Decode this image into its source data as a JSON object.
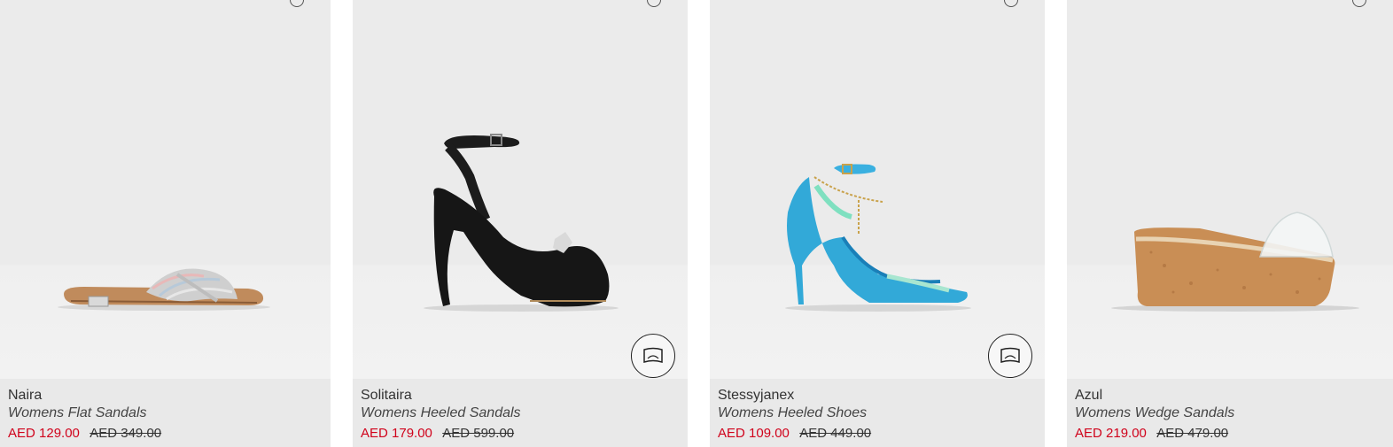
{
  "products": [
    {
      "name": "Naira",
      "category": "Womens Flat Sandals",
      "sale_price": "AED 129.00",
      "original_price": "AED 349.00",
      "has_3d_view": false
    },
    {
      "name": "Solitaira",
      "category": "Womens Heeled Sandals",
      "sale_price": "AED 179.00",
      "original_price": "AED 599.00",
      "has_3d_view": true
    },
    {
      "name": "Stessyjanex",
      "category": "Womens Heeled Shoes",
      "sale_price": "AED 109.00",
      "original_price": "AED 449.00",
      "has_3d_view": true
    },
    {
      "name": "Azul",
      "category": "Womens Wedge Sandals",
      "sale_price": "AED 219.00",
      "original_price": "AED 479.00",
      "has_3d_view": false
    }
  ],
  "colors": {
    "sale_price": "#d0021b",
    "info_background": "#e9e9e9",
    "image_background": "#ebebeb"
  },
  "icons": {
    "ar_view": "3d-view-icon",
    "wishlist": "heart-icon"
  }
}
